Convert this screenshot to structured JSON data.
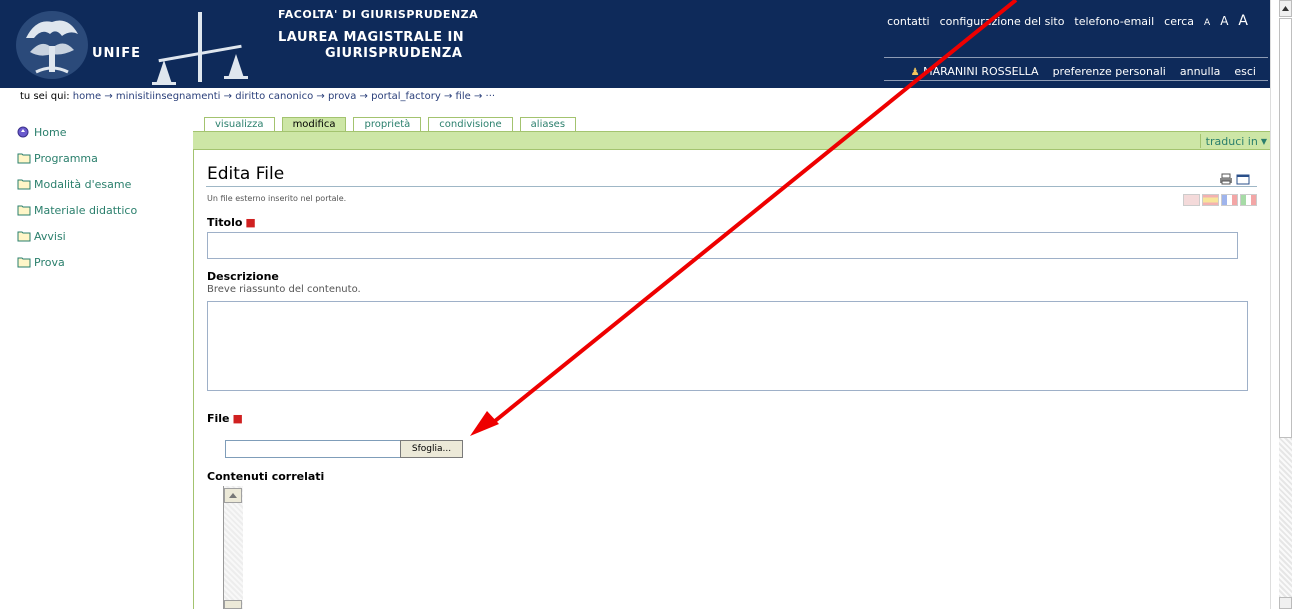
{
  "header": {
    "logo_text": "UNIFE",
    "faculty": "FACOLTA' DI GIURISPRUDENZA",
    "degree_line_1": "LAUREA MAGISTRALE IN",
    "degree_line_2": "GIURISPRUDENZA",
    "site_actions": [
      "contatti",
      "configurazione del sito",
      "telefono-email",
      "cerca"
    ],
    "text_size_labels": [
      "A",
      "A",
      "A"
    ],
    "user_name": "MARANINI ROSSELLA",
    "user_actions": [
      "preferenze personali",
      "annulla",
      "esci"
    ]
  },
  "breadcrumb": {
    "label": "tu sei qui:",
    "items": [
      "home",
      "minisitiinsegnamenti",
      "diritto canonico",
      "prova",
      "portal_factory",
      "file",
      "···"
    ],
    "separator": "→"
  },
  "sidebar": {
    "items": [
      {
        "label": "Home",
        "icon": "home-icon"
      },
      {
        "label": "Programma",
        "icon": "folder-icon"
      },
      {
        "label": "Modalità d'esame",
        "icon": "folder-icon"
      },
      {
        "label": "Materiale didattico",
        "icon": "folder-icon"
      },
      {
        "label": "Avvisi",
        "icon": "folder-icon"
      },
      {
        "label": "Prova",
        "icon": "folder-icon"
      }
    ]
  },
  "tabs": [
    {
      "label": "visualizza",
      "active": false
    },
    {
      "label": "modifica",
      "active": true
    },
    {
      "label": "proprietà",
      "active": false
    },
    {
      "label": "condivisione",
      "active": false
    },
    {
      "label": "aliases",
      "active": false
    }
  ],
  "content_bar": {
    "translate_label": "traduci in",
    "translate_icon": "chevron-down-icon"
  },
  "form": {
    "title": "Edita File",
    "description": "Un file esterno inserito nel portale.",
    "title_field": {
      "label": "Titolo",
      "value": ""
    },
    "description_field": {
      "label": "Descrizione",
      "help": "Breve riassunto del contenuto.",
      "value": ""
    },
    "file_field": {
      "label": "File",
      "value": "",
      "browse_label": "Sfoglia..."
    },
    "related_field": {
      "label": "Contenuti correlati"
    }
  },
  "colors": {
    "header_bg": "#0e2a5a",
    "tab_active_bg": "#cde6a6",
    "link_green": "#2a7f6c",
    "required_red": "#d02020",
    "annotation_arrow": "#ee0000"
  }
}
